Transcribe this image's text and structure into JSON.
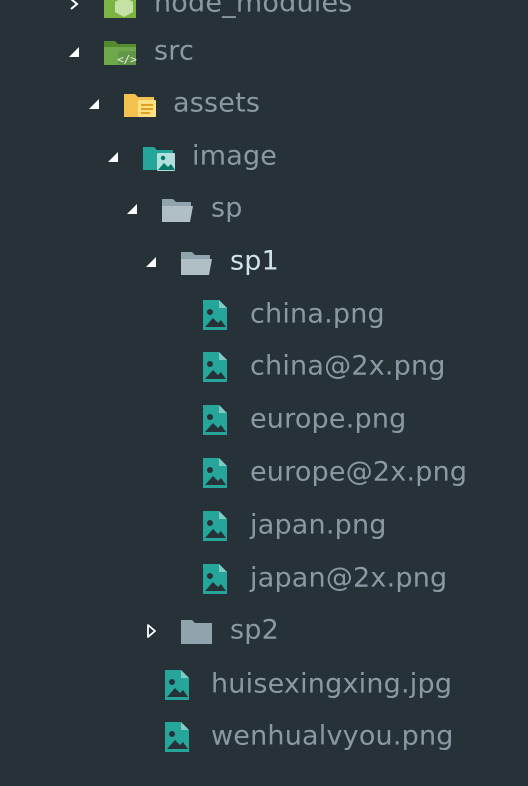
{
  "colors": {
    "background": "#263238",
    "text": "#8a99a3",
    "text_active": "#cfe3ea",
    "folder_gray": "#90a4ae",
    "folder_green": "#6fa84a",
    "folder_yellow": "#f2c14e",
    "image_teal": "#2bb3a0",
    "node_green": "#8bc34a"
  },
  "tree": {
    "node_modules": {
      "label": "node_modules",
      "icon": "node-folder-icon"
    },
    "src": {
      "label": "src",
      "icon": "source-folder-icon"
    },
    "assets": {
      "label": "assets",
      "icon": "assets-folder-icon"
    },
    "image": {
      "label": "image",
      "icon": "image-folder-icon"
    },
    "sp": {
      "label": "sp",
      "icon": "folder-open-icon"
    },
    "sp1": {
      "label": "sp1",
      "icon": "folder-open-icon"
    },
    "sp1_files": [
      {
        "label": "china.png",
        "icon": "image-file-icon"
      },
      {
        "label": "china@2x.png",
        "icon": "image-file-icon"
      },
      {
        "label": "europe.png",
        "icon": "image-file-icon"
      },
      {
        "label": "europe@2x.png",
        "icon": "image-file-icon"
      },
      {
        "label": "japan.png",
        "icon": "image-file-icon"
      },
      {
        "label": "japan@2x.png",
        "icon": "image-file-icon"
      }
    ],
    "sp2": {
      "label": "sp2",
      "icon": "folder-closed-icon"
    },
    "sp_files": [
      {
        "label": "huisexingxing.jpg",
        "icon": "image-file-icon"
      },
      {
        "label": "wenhualvyou.png",
        "icon": "image-file-icon"
      }
    ]
  }
}
